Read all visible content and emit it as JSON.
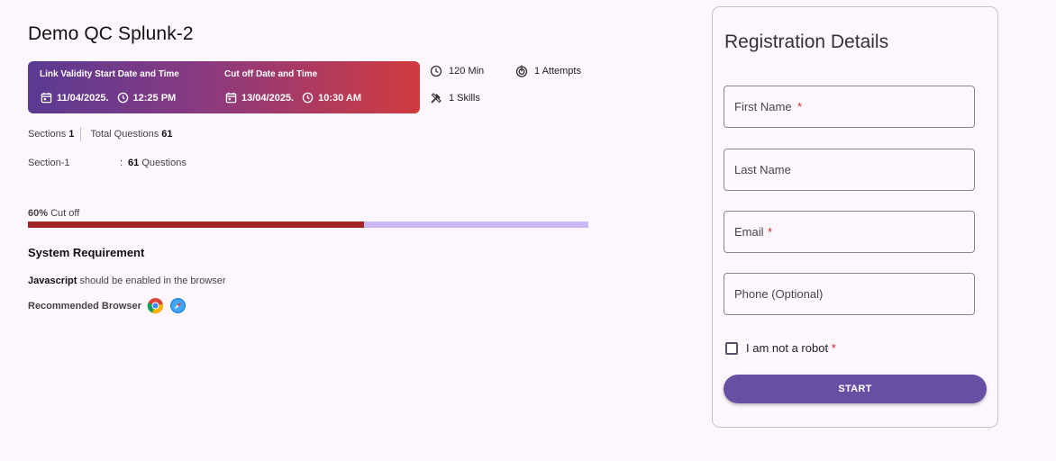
{
  "test": {
    "title": "Demo QC Splunk-2"
  },
  "banner": {
    "start_label": "Link Validity Start Date and Time",
    "start_date": "11/04/2025.",
    "start_time": "12:25 PM",
    "cutoff_label": "Cut off Date and Time",
    "cutoff_date": "13/04/2025.",
    "cutoff_time": "10:30 AM",
    "gradient_start": "#5a3a93",
    "gradient_end": "#d13b3f"
  },
  "meta": {
    "duration": "120 Min",
    "attempts": "1 Attempts",
    "skills": "1 Skills",
    "duration_icon": "clock-icon",
    "attempts_icon": "target-icon",
    "skills_icon": "tools-icon"
  },
  "summary": {
    "sections_label": "Sections",
    "sections_count": "1",
    "questions_label": "Total Questions",
    "questions_count": "61"
  },
  "section_list": [
    {
      "name": "Section-1",
      "colon": ":",
      "count": "61",
      "unit": "Questions"
    }
  ],
  "cutoff": {
    "percent_text": "60%",
    "label": "Cut off",
    "fraction": 0.6,
    "fill_color": "#a32626",
    "track_color": "#cbb9f7"
  },
  "system": {
    "heading": "System Requirement",
    "js_bold": "Javascript",
    "js_rest": "should be enabled in the browser",
    "browser_label": "Recommended Browser",
    "browsers": [
      "chrome-icon",
      "safari-icon"
    ]
  },
  "registration": {
    "title": "Registration Details",
    "fields": [
      {
        "placeholder": "First Name",
        "required": "*"
      },
      {
        "placeholder": "Last Name",
        "required": ""
      },
      {
        "placeholder": "Email",
        "required": "*"
      },
      {
        "placeholder": "Phone (Optional)",
        "required": ""
      }
    ],
    "robot_label": "I am not a robot",
    "robot_required": "*",
    "start_label": "START",
    "accent": "#6750a4"
  }
}
